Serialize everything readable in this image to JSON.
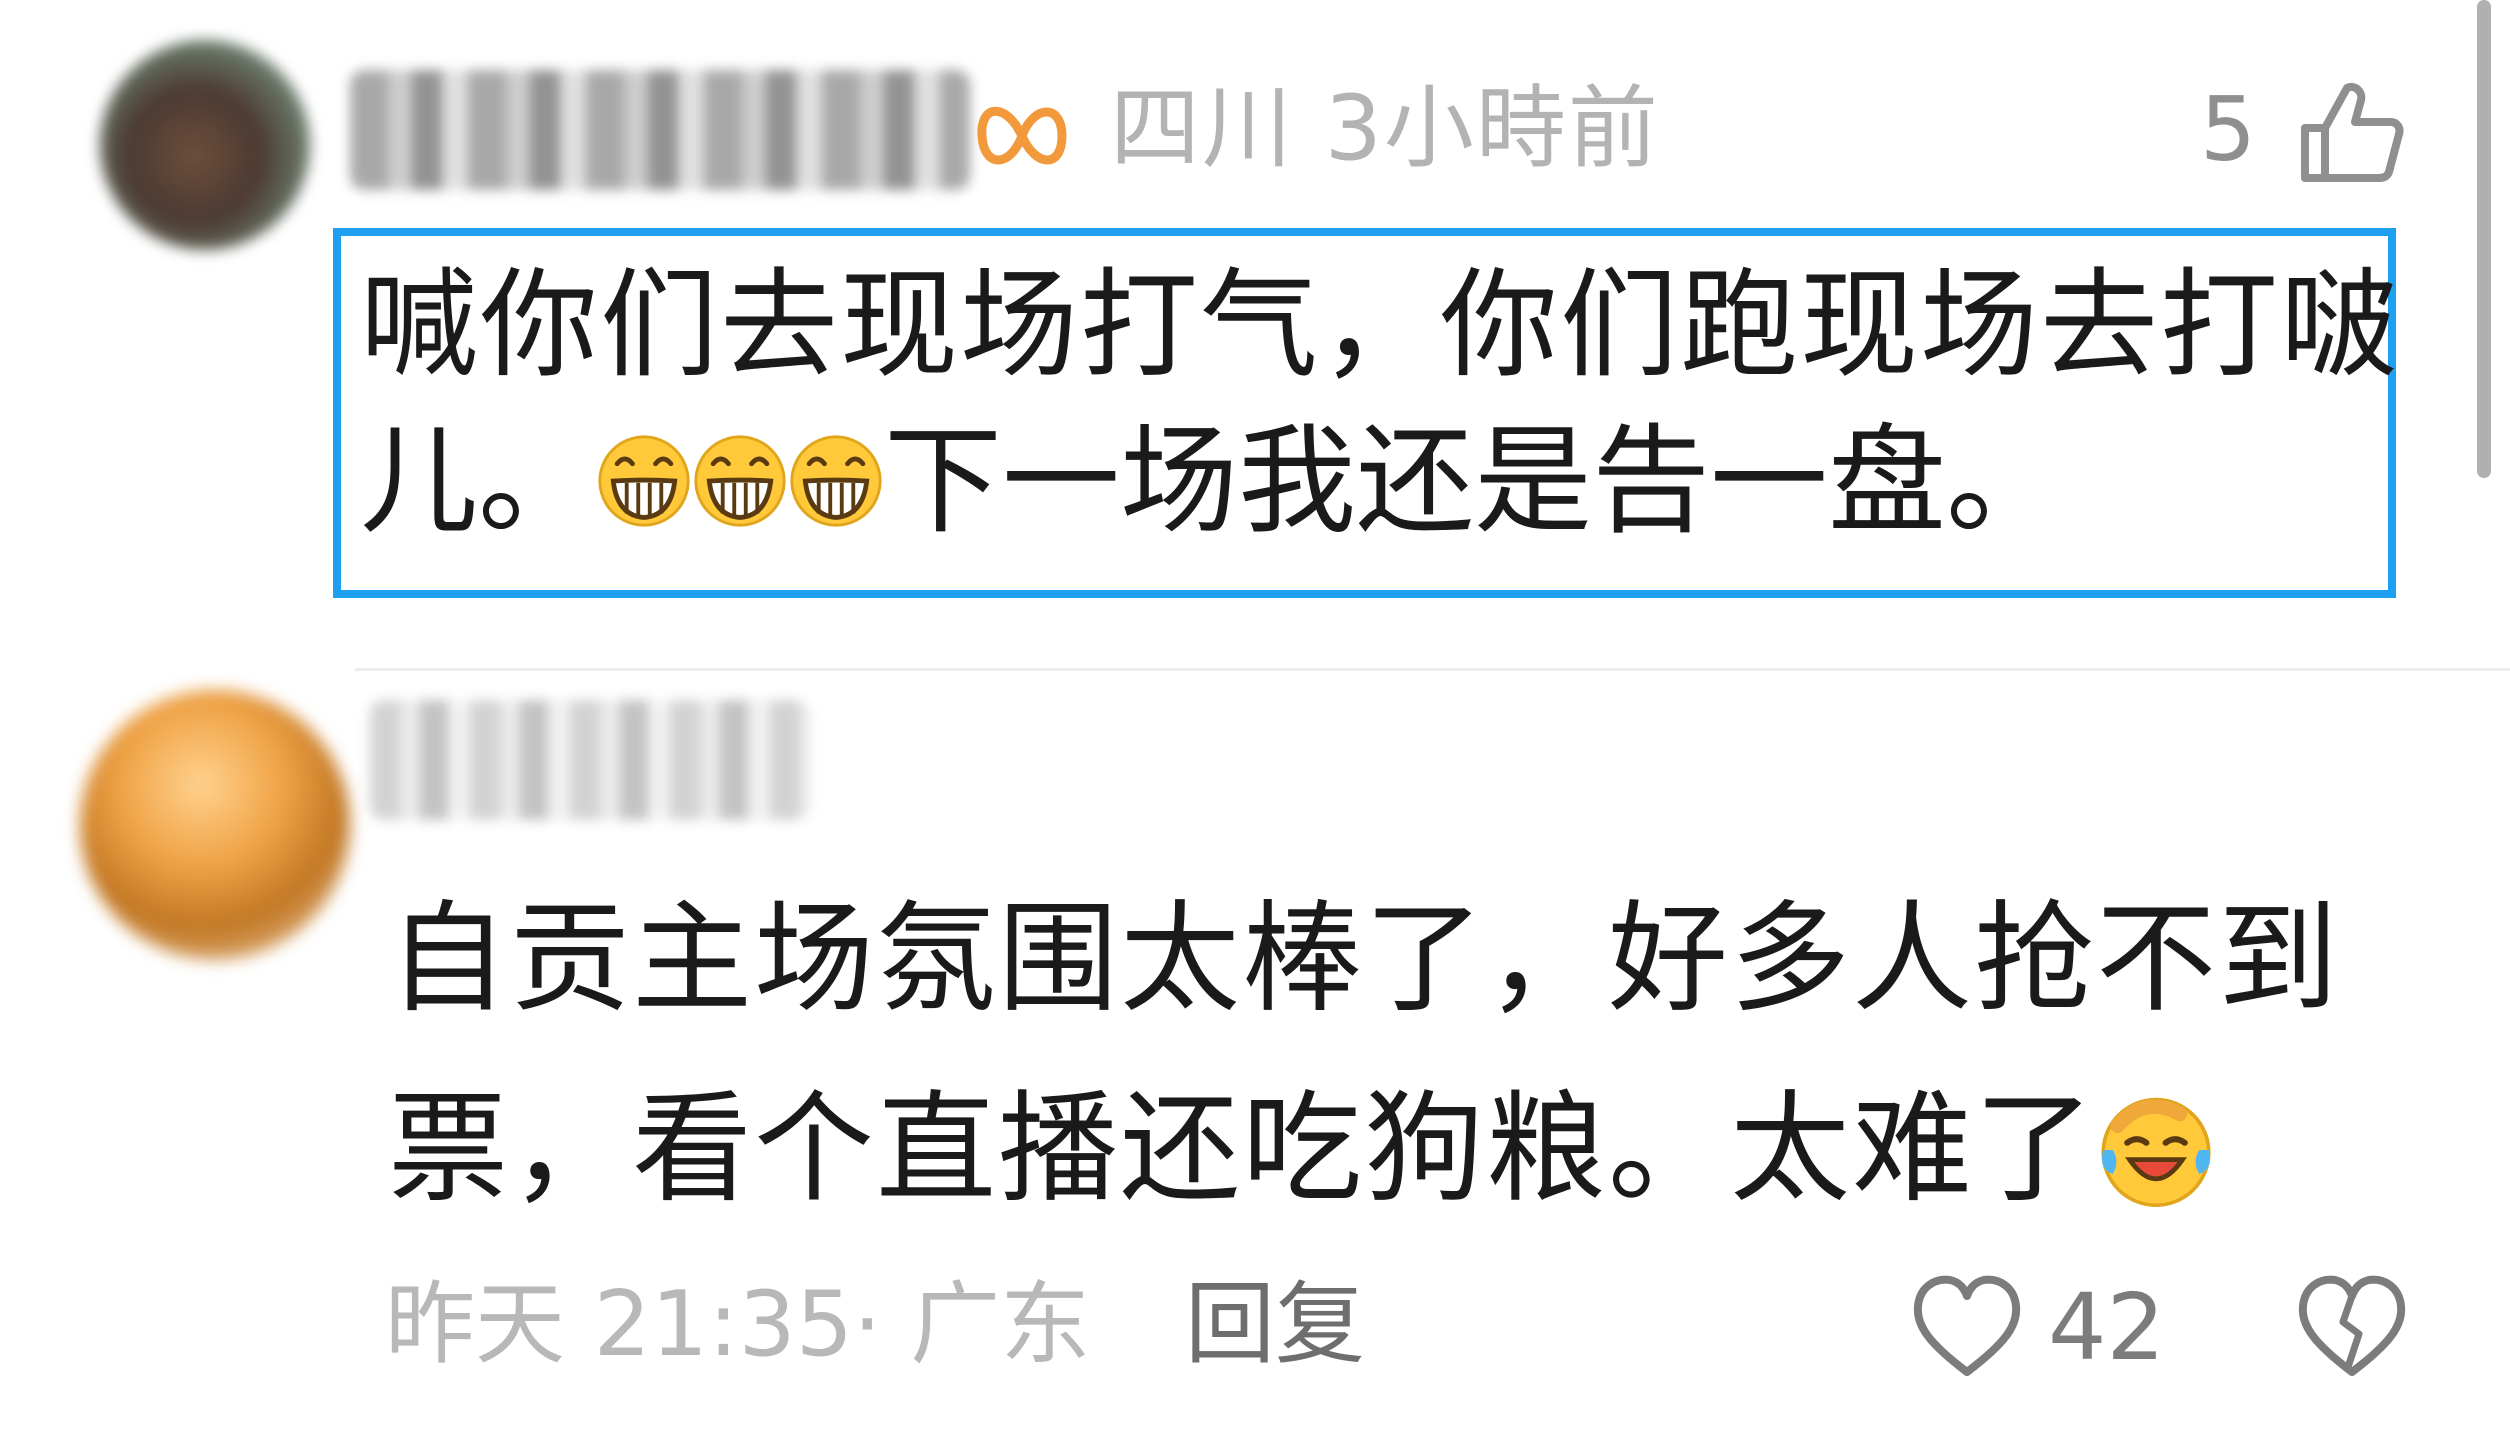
{
  "comments": [
    {
      "username": "",
      "location": "四川",
      "time": "3小時前",
      "meta_text": "四川 3小時前",
      "like_count": "5",
      "line1": "喊你们去现场打气，你们跑现场去打啵",
      "line2_prefix": "儿。",
      "line2_suffix": "下一场我还是告一盘。",
      "emoji": [
        "grin-emoji",
        "grin-emoji",
        "grin-emoji"
      ],
      "highlight_color": "#1ea0f0"
    },
    {
      "username": "",
      "line1": "自贡主场氛围太棒了，好多人抢不到",
      "line2": "票，看个直播还吃狗粮。太难了",
      "emoji": [
        "laugh-cry-emoji"
      ],
      "date_location": "昨天 21:35· 广东",
      "reply_label": "回复",
      "like_count": "42"
    }
  ],
  "icons": {
    "badge": "orange-infinity-badge-icon",
    "thumb": "thumbs-up-icon",
    "heart": "heart-icon",
    "dislike": "broken-heart-icon"
  },
  "colors": {
    "text": "#1a1a1a",
    "meta": "#b3b3b3",
    "accent_badge": "#f29a3b"
  }
}
